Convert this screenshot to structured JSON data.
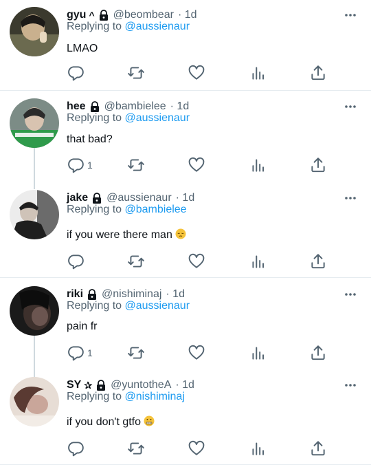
{
  "tweets": [
    {
      "name": "gyu",
      "name_extra": "^",
      "handle": "@beombear",
      "time": "· 1d",
      "replying_prefix": "Replying to ",
      "replying_to": "@aussienaur",
      "text": "LMAO",
      "emoji": "",
      "reply_count": "",
      "avatar_colors": [
        "#3b3a2e",
        "#c9b08e",
        "#e8d9c0"
      ]
    },
    {
      "name": "hee",
      "name_extra": "",
      "handle": "@bambielee",
      "time": "· 1d",
      "replying_prefix": "Replying to ",
      "replying_to": "@aussienaur",
      "text": "that bad?",
      "emoji": "",
      "reply_count": "1",
      "avatar_colors": [
        "#7c8c86",
        "#2b2b2b",
        "#2f9a4b"
      ]
    },
    {
      "name": "jake",
      "name_extra": "",
      "handle": "@aussienaur",
      "time": "· 1d",
      "replying_prefix": "Replying to ",
      "replying_to": "@bambielee",
      "text": "if you were there man",
      "emoji": "pensive-face",
      "reply_count": "",
      "avatar_colors": [
        "#ececec",
        "#1e1e1e",
        "#6b6b6b"
      ]
    },
    {
      "name": "riki",
      "name_extra": "",
      "handle": "@nishiminaj",
      "time": "· 1d",
      "replying_prefix": "Replying to ",
      "replying_to": "@aussienaur",
      "text": "pain fr",
      "emoji": "",
      "reply_count": "1",
      "avatar_colors": [
        "#1a1a1a",
        "#3d302c",
        "#6b5550"
      ]
    },
    {
      "name": "SY",
      "name_extra": "✰",
      "handle": "@yuntotheA",
      "time": "· 1d",
      "replying_prefix": "Replying to ",
      "replying_to": "@nishiminaj",
      "text": "if you don't gtfo",
      "emoji": "grimacing-face",
      "reply_count": "",
      "avatar_colors": [
        "#e7ddd5",
        "#5a3a32",
        "#c9a69a"
      ]
    }
  ],
  "icons": {
    "reply": "reply-icon",
    "retweet": "retweet-icon",
    "like": "heart-icon",
    "views": "views-icon",
    "share": "share-icon",
    "more": "more-icon",
    "lock": "lock-icon"
  },
  "colors": {
    "text": "#0f1419",
    "secondary": "#536471",
    "link": "#1d9bf0",
    "divider": "#e6ecf0",
    "thread_line": "#cfd9de"
  }
}
